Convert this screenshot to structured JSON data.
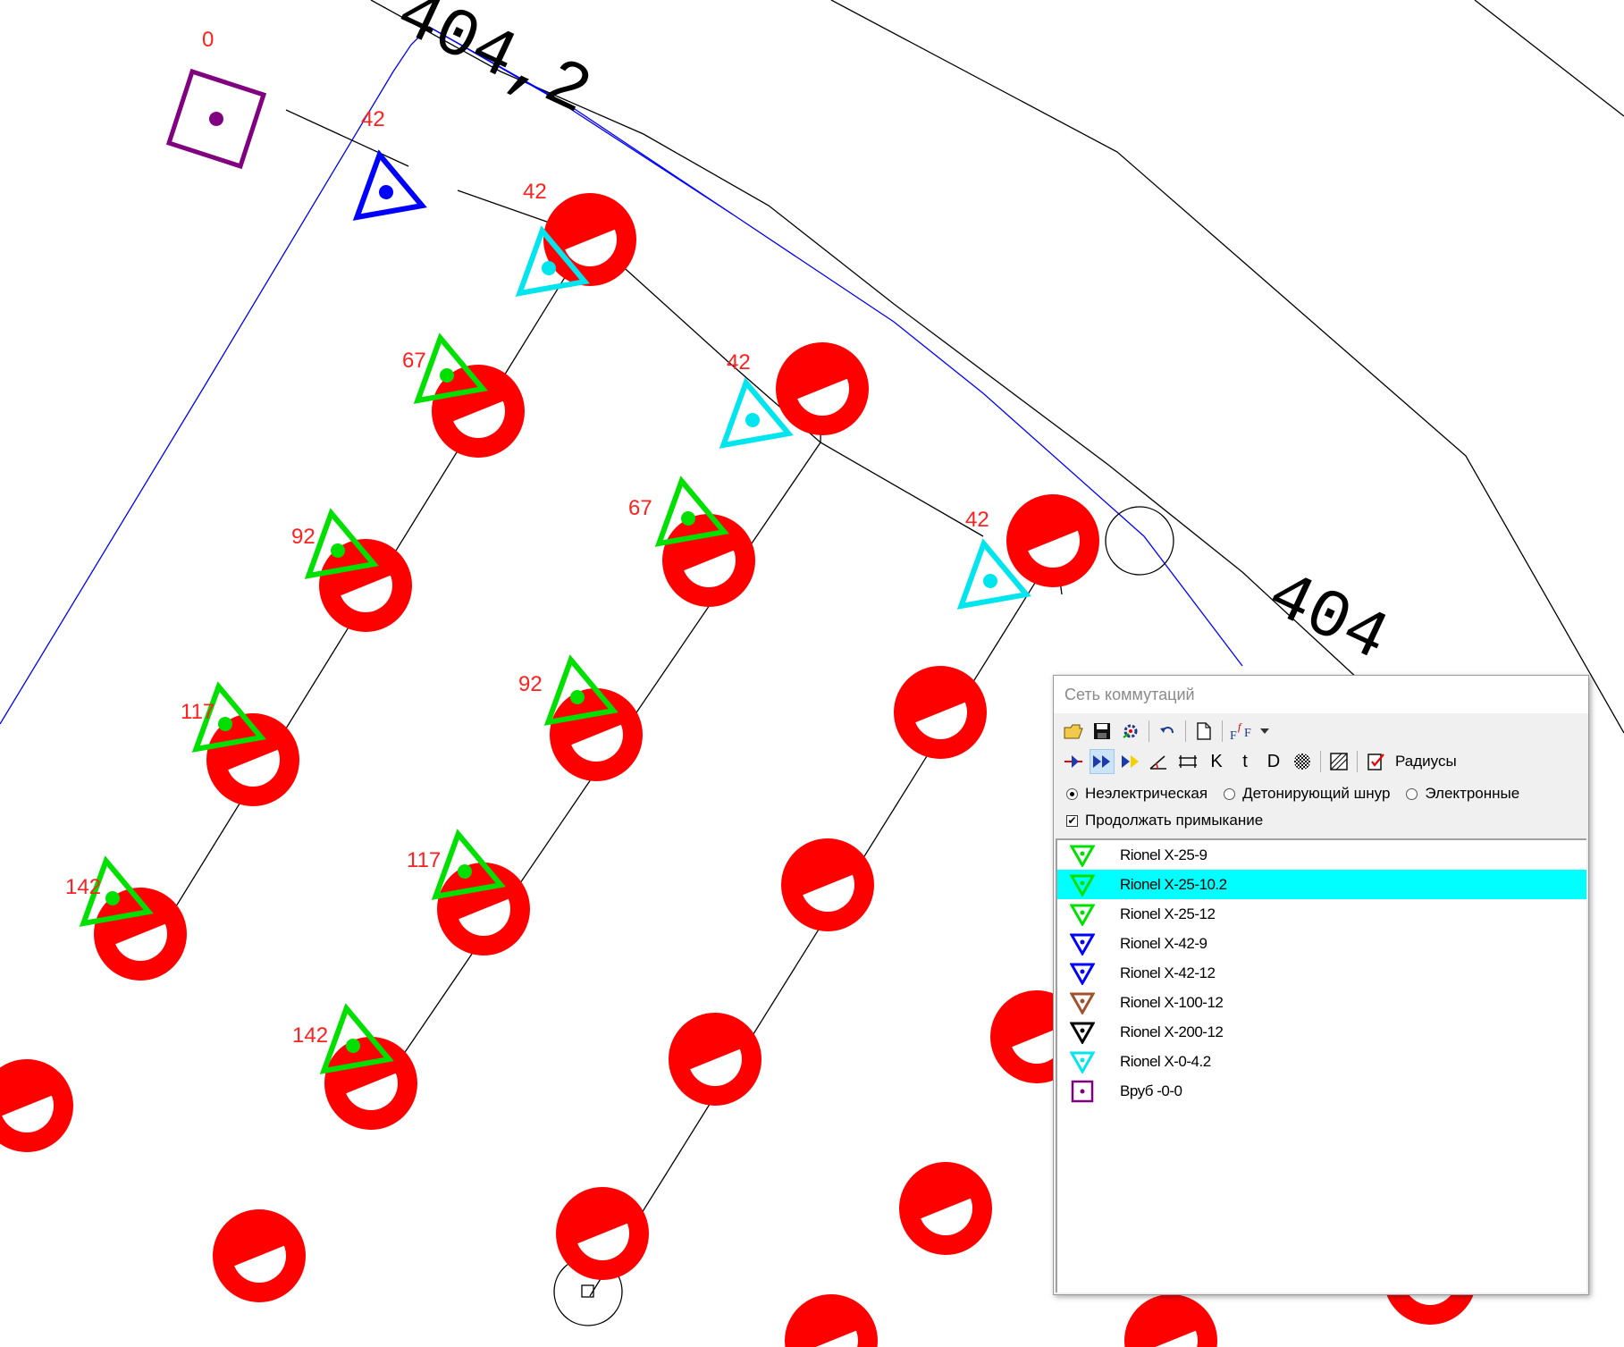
{
  "canvas": {
    "elevation_labels": [
      "404,2",
      "404"
    ],
    "hole_labels": [
      "0",
      "42",
      "42",
      "42",
      "42",
      "67",
      "67",
      "92",
      "92",
      "117",
      "117",
      "142",
      "142"
    ],
    "colors": {
      "hole": "#ff0000",
      "connector_green": "#00e000",
      "connector_blue": "#0000ff",
      "connector_cyan": "#00e5ee",
      "cut_marker": "#800080",
      "boundary_line": "#0000ff",
      "network_line": "#000000"
    }
  },
  "panel": {
    "title": "Сеть коммутаций",
    "toolbar1": {
      "icons": [
        "open-folder-icon",
        "save-icon",
        "settings-icon",
        "undo-icon",
        "new-page-icon",
        "font-icon",
        "dropdown-arrow-icon"
      ]
    },
    "toolbar2": {
      "icons": [
        "single-arrow-icon",
        "double-arrow-icon",
        "double-arrow-yellow-icon",
        "angle-icon",
        "spacing-icon",
        "hatch-icon",
        "hatch-diagonal-icon",
        "checklist-icon"
      ],
      "letters": [
        "K",
        "t",
        "D"
      ],
      "radii_label": "Радиусы"
    },
    "initiation_modes": [
      {
        "label": "Неэлектрическая",
        "selected": true
      },
      {
        "label": "Детонирующий шнур",
        "selected": false
      },
      {
        "label": "Электронные",
        "selected": false
      }
    ],
    "continue_connection": {
      "label": "Продолжать примыкание",
      "checked": true
    },
    "detonators": [
      {
        "name": "Rionel X-25-9",
        "color": "#00e000",
        "icon": "triangle-down-icon",
        "selected": false
      },
      {
        "name": "Rionel X-25-10.2",
        "color": "#00e000",
        "icon": "triangle-down-icon",
        "selected": true
      },
      {
        "name": "Rionel X-25-12",
        "color": "#00e000",
        "icon": "triangle-down-icon",
        "selected": false
      },
      {
        "name": "Rionel X-42-9",
        "color": "#0000ff",
        "icon": "triangle-down-icon",
        "selected": false
      },
      {
        "name": "Rionel X-42-12",
        "color": "#0000ff",
        "icon": "triangle-down-icon",
        "selected": false
      },
      {
        "name": "Rionel X-100-12",
        "color": "#a0522d",
        "icon": "triangle-down-icon",
        "selected": false
      },
      {
        "name": "Rionel X-200-12",
        "color": "#000000",
        "icon": "triangle-down-icon",
        "selected": false
      },
      {
        "name": "Rionel X-0-4.2",
        "color": "#00e5ee",
        "icon": "triangle-down-icon",
        "selected": false
      },
      {
        "name": "Вруб -0-0",
        "color": "#800080",
        "icon": "square-dot-icon",
        "selected": false
      }
    ]
  }
}
